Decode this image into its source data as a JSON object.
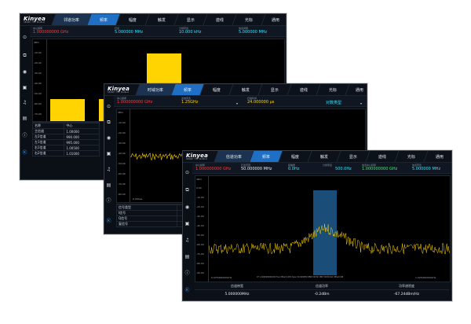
{
  "brand": {
    "name": "Kinyea",
    "tagline": "SENSE THE WORLD"
  },
  "win1": {
    "tabs": [
      "邻道功率",
      "频率",
      "幅度",
      "触发",
      "显示",
      "迹线",
      "光标",
      "通用"
    ],
    "params": [
      {
        "label": "中心频率",
        "value": "1.000000000 GHz"
      },
      {
        "label": "扫宽",
        "value": "5.000000 MHz"
      },
      {
        "label": "分辨带宽",
        "value": "10.000 kHz"
      },
      {
        "label": "信道间隔",
        "value": "5.000000 MHz"
      }
    ],
    "ylabels": [
      "dBm",
      "-10.00",
      "-20.00",
      "-30.00",
      "-40.00",
      "-50.00",
      "-60.00",
      "-70.00"
    ],
    "table_head": [
      "名称",
      "中心"
    ],
    "table_rows": [
      [
        "主信道",
        "1.00000"
      ],
      [
        "左2信道",
        "990.000"
      ],
      [
        "左1信道",
        "995.000"
      ],
      [
        "右1信道",
        "1.00500"
      ],
      [
        "右2信道",
        "1.01000"
      ]
    ]
  },
  "win2": {
    "tabs": [
      "时域功率",
      "频率",
      "幅度",
      "触发",
      "显示",
      "迹线",
      "光标",
      "通用"
    ],
    "params": [
      {
        "label": "中心频率",
        "value": "1.000000000 GHz"
      },
      {
        "label": "滤波带宽",
        "value": "1.25GHz"
      },
      {
        "label": "扫描时间",
        "value": "24.000000 μs"
      },
      {
        "label": "",
        "value": "对数类型"
      }
    ],
    "ylabels": [
      "dBm",
      "-10.00",
      "-20.00",
      "-30.00",
      "-40.00",
      "-50.00",
      "-60.00",
      "-70.00",
      "-80.00"
    ],
    "xstart": "0.000μs",
    "table_head": [
      "信号类型",
      ""
    ],
    "table_rows": [
      [
        "I信号",
        ""
      ],
      [
        "Q信号",
        ""
      ],
      [
        "复信号",
        ""
      ]
    ]
  },
  "win3": {
    "tabs": [
      "信道功率",
      "频率",
      "幅度",
      "触发",
      "显示",
      "迹线",
      "光标",
      "通用"
    ],
    "params": [
      {
        "label": "中心频率",
        "value": "1.000000000 GHz"
      },
      {
        "label": "扫宽范围",
        "value": "50.000000 MHz"
      },
      {
        "label": "频偏量",
        "value": "0.0Hz"
      },
      {
        "label": "分辨带宽",
        "value": "500.0Hz"
      },
      {
        "label": "信道中心频率",
        "value": "1.000000000 GHz"
      },
      {
        "label": "信道带宽",
        "value": "5.000000 MHz"
      }
    ],
    "ylabels": [
      "dBm",
      "0.00",
      "-10.00",
      "-20.00",
      "-30.00",
      "-40.00",
      "-50.00",
      "-60.00",
      "-70.00",
      "-80.00",
      "-90.00"
    ],
    "xstart": "0.975000000GHz",
    "xmid": "CF 1.000000000GHz Freq Offset 0.0Hz Span 50.000MHz RBW 500Hz VBW 500Hz Ref Offset 0dB",
    "xend": "1.025000000GHz",
    "footer_heads": [
      "信道带宽",
      "信道功率",
      "功率谱密度"
    ],
    "footer_vals": [
      "5.000000MHz",
      "-0.2dBm",
      "-67.24dBm/Hz"
    ]
  }
}
